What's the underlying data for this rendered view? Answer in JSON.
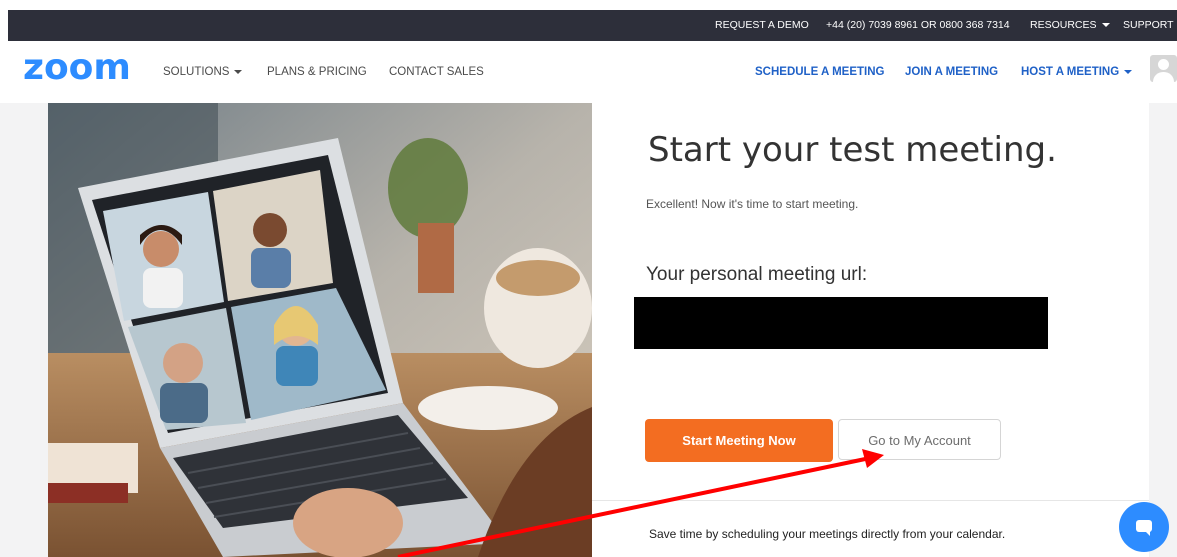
{
  "topbar": {
    "request_demo": "REQUEST A DEMO",
    "phone": "+44 (20) 7039 8961 OR 0800 368 7314",
    "resources": "RESOURCES",
    "support": "SUPPORT"
  },
  "nav": {
    "logo": "zoom",
    "solutions": "SOLUTIONS",
    "plans": "PLANS & PRICING",
    "contact": "CONTACT SALES",
    "schedule": "SCHEDULE A MEETING",
    "join": "JOIN A MEETING",
    "host": "HOST A MEETING"
  },
  "main": {
    "title": "Start your test meeting.",
    "subtitle": "Excellent! Now it's time to start meeting.",
    "url_label": "Your personal meeting url:",
    "start_button": "Start Meeting Now",
    "account_button": "Go to My Account",
    "calendar_note": "Save time by scheduling your meetings directly from your calendar."
  },
  "colors": {
    "brand_blue": "#2d8cff",
    "orange": "#f36d21",
    "annotation_red": "#ff0000"
  },
  "icons": {
    "avatar": "user-avatar-icon",
    "chat": "chat-bubble-icon"
  }
}
